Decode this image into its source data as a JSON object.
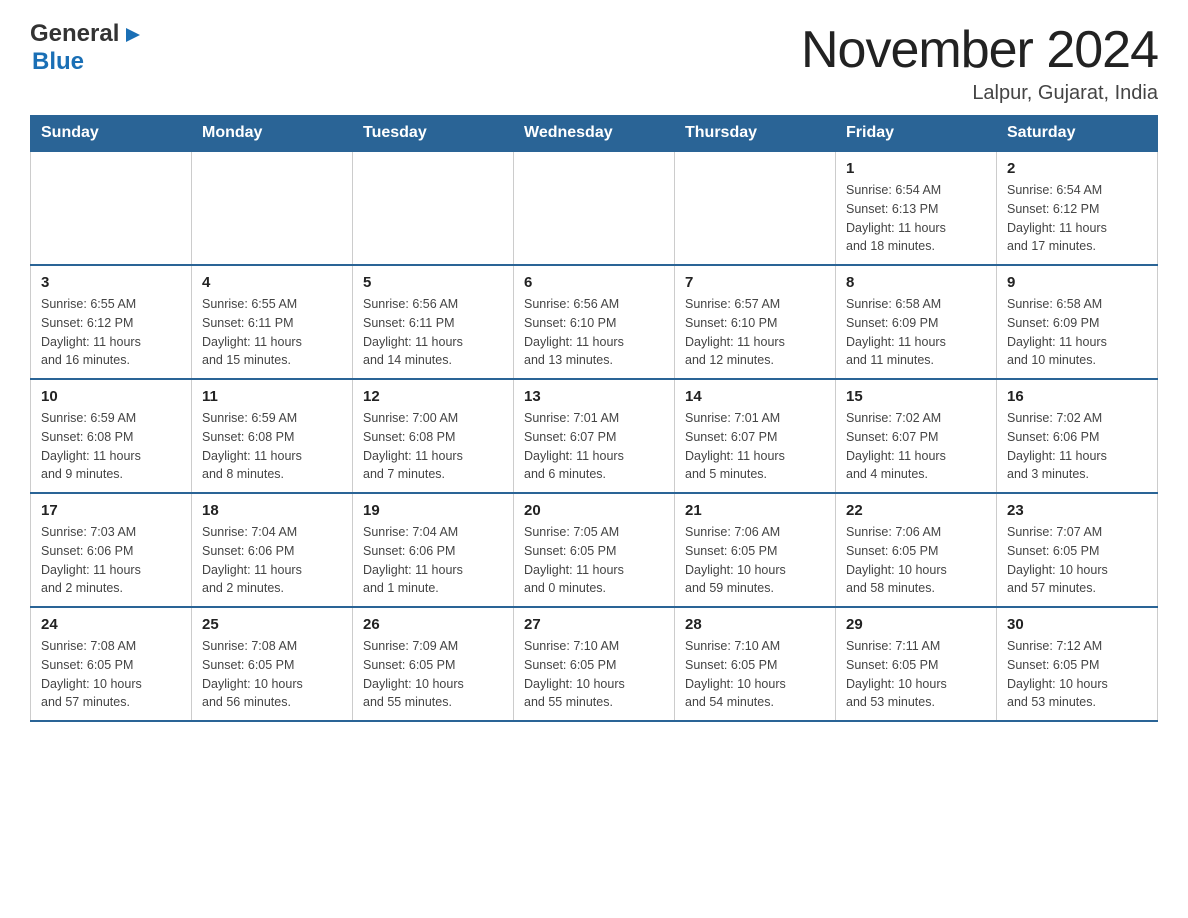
{
  "logo": {
    "general": "General",
    "blue": "Blue"
  },
  "header": {
    "month_year": "November 2024",
    "location": "Lalpur, Gujarat, India"
  },
  "weekdays": [
    "Sunday",
    "Monday",
    "Tuesday",
    "Wednesday",
    "Thursday",
    "Friday",
    "Saturday"
  ],
  "rows": [
    {
      "cells": [
        {
          "day": "",
          "info": ""
        },
        {
          "day": "",
          "info": ""
        },
        {
          "day": "",
          "info": ""
        },
        {
          "day": "",
          "info": ""
        },
        {
          "day": "",
          "info": ""
        },
        {
          "day": "1",
          "info": "Sunrise: 6:54 AM\nSunset: 6:13 PM\nDaylight: 11 hours\nand 18 minutes."
        },
        {
          "day": "2",
          "info": "Sunrise: 6:54 AM\nSunset: 6:12 PM\nDaylight: 11 hours\nand 17 minutes."
        }
      ]
    },
    {
      "cells": [
        {
          "day": "3",
          "info": "Sunrise: 6:55 AM\nSunset: 6:12 PM\nDaylight: 11 hours\nand 16 minutes."
        },
        {
          "day": "4",
          "info": "Sunrise: 6:55 AM\nSunset: 6:11 PM\nDaylight: 11 hours\nand 15 minutes."
        },
        {
          "day": "5",
          "info": "Sunrise: 6:56 AM\nSunset: 6:11 PM\nDaylight: 11 hours\nand 14 minutes."
        },
        {
          "day": "6",
          "info": "Sunrise: 6:56 AM\nSunset: 6:10 PM\nDaylight: 11 hours\nand 13 minutes."
        },
        {
          "day": "7",
          "info": "Sunrise: 6:57 AM\nSunset: 6:10 PM\nDaylight: 11 hours\nand 12 minutes."
        },
        {
          "day": "8",
          "info": "Sunrise: 6:58 AM\nSunset: 6:09 PM\nDaylight: 11 hours\nand 11 minutes."
        },
        {
          "day": "9",
          "info": "Sunrise: 6:58 AM\nSunset: 6:09 PM\nDaylight: 11 hours\nand 10 minutes."
        }
      ]
    },
    {
      "cells": [
        {
          "day": "10",
          "info": "Sunrise: 6:59 AM\nSunset: 6:08 PM\nDaylight: 11 hours\nand 9 minutes."
        },
        {
          "day": "11",
          "info": "Sunrise: 6:59 AM\nSunset: 6:08 PM\nDaylight: 11 hours\nand 8 minutes."
        },
        {
          "day": "12",
          "info": "Sunrise: 7:00 AM\nSunset: 6:08 PM\nDaylight: 11 hours\nand 7 minutes."
        },
        {
          "day": "13",
          "info": "Sunrise: 7:01 AM\nSunset: 6:07 PM\nDaylight: 11 hours\nand 6 minutes."
        },
        {
          "day": "14",
          "info": "Sunrise: 7:01 AM\nSunset: 6:07 PM\nDaylight: 11 hours\nand 5 minutes."
        },
        {
          "day": "15",
          "info": "Sunrise: 7:02 AM\nSunset: 6:07 PM\nDaylight: 11 hours\nand 4 minutes."
        },
        {
          "day": "16",
          "info": "Sunrise: 7:02 AM\nSunset: 6:06 PM\nDaylight: 11 hours\nand 3 minutes."
        }
      ]
    },
    {
      "cells": [
        {
          "day": "17",
          "info": "Sunrise: 7:03 AM\nSunset: 6:06 PM\nDaylight: 11 hours\nand 2 minutes."
        },
        {
          "day": "18",
          "info": "Sunrise: 7:04 AM\nSunset: 6:06 PM\nDaylight: 11 hours\nand 2 minutes."
        },
        {
          "day": "19",
          "info": "Sunrise: 7:04 AM\nSunset: 6:06 PM\nDaylight: 11 hours\nand 1 minute."
        },
        {
          "day": "20",
          "info": "Sunrise: 7:05 AM\nSunset: 6:05 PM\nDaylight: 11 hours\nand 0 minutes."
        },
        {
          "day": "21",
          "info": "Sunrise: 7:06 AM\nSunset: 6:05 PM\nDaylight: 10 hours\nand 59 minutes."
        },
        {
          "day": "22",
          "info": "Sunrise: 7:06 AM\nSunset: 6:05 PM\nDaylight: 10 hours\nand 58 minutes."
        },
        {
          "day": "23",
          "info": "Sunrise: 7:07 AM\nSunset: 6:05 PM\nDaylight: 10 hours\nand 57 minutes."
        }
      ]
    },
    {
      "cells": [
        {
          "day": "24",
          "info": "Sunrise: 7:08 AM\nSunset: 6:05 PM\nDaylight: 10 hours\nand 57 minutes."
        },
        {
          "day": "25",
          "info": "Sunrise: 7:08 AM\nSunset: 6:05 PM\nDaylight: 10 hours\nand 56 minutes."
        },
        {
          "day": "26",
          "info": "Sunrise: 7:09 AM\nSunset: 6:05 PM\nDaylight: 10 hours\nand 55 minutes."
        },
        {
          "day": "27",
          "info": "Sunrise: 7:10 AM\nSunset: 6:05 PM\nDaylight: 10 hours\nand 55 minutes."
        },
        {
          "day": "28",
          "info": "Sunrise: 7:10 AM\nSunset: 6:05 PM\nDaylight: 10 hours\nand 54 minutes."
        },
        {
          "day": "29",
          "info": "Sunrise: 7:11 AM\nSunset: 6:05 PM\nDaylight: 10 hours\nand 53 minutes."
        },
        {
          "day": "30",
          "info": "Sunrise: 7:12 AM\nSunset: 6:05 PM\nDaylight: 10 hours\nand 53 minutes."
        }
      ]
    }
  ]
}
